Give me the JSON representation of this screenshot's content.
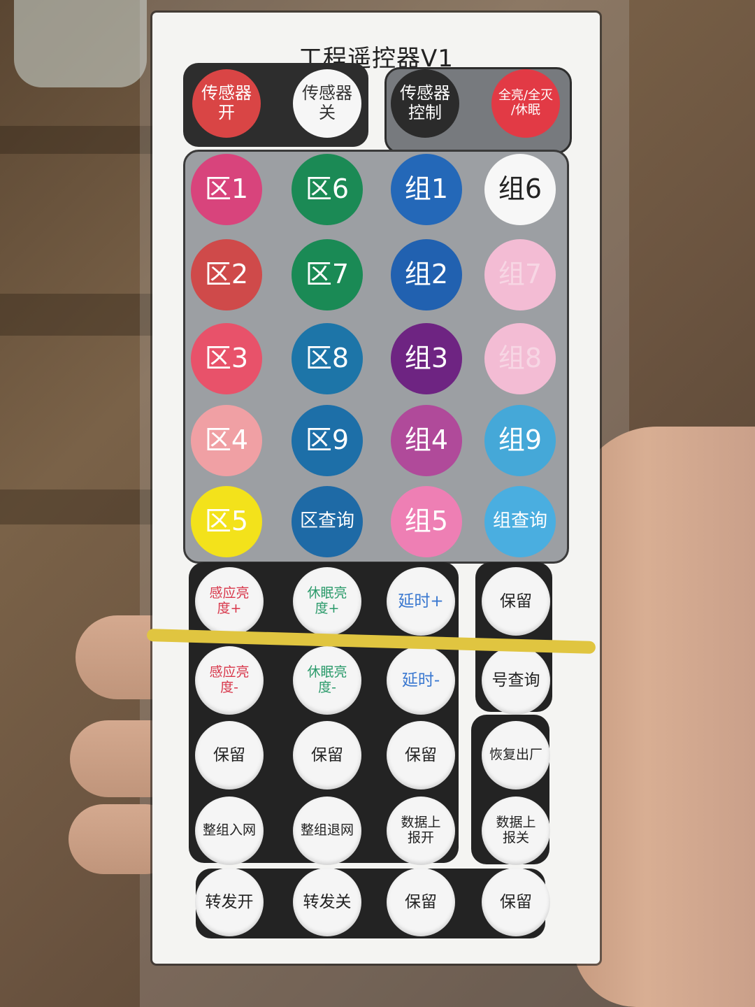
{
  "title": "工程遥控器V1",
  "top_row": [
    {
      "label": "传感器\n开",
      "bg": "#d94545",
      "fg": "#ffffff"
    },
    {
      "label": "传感器\n关",
      "bg": "#f6f6f6",
      "fg": "#333333"
    },
    {
      "label": "传感器\n控制",
      "bg": "#2b2b2b",
      "fg": "#ffffff"
    },
    {
      "label": "全亮/全灭\n/休眠",
      "bg": "#e23a45",
      "fg": "#ffffff"
    }
  ],
  "grid_rows": [
    [
      {
        "label": "区1",
        "bg": "#d8447c",
        "fg": "#ffffff"
      },
      {
        "label": "区6",
        "bg": "#1b8a55",
        "fg": "#ffffff"
      },
      {
        "label": "组1",
        "bg": "#2468b8",
        "fg": "#ffffff"
      },
      {
        "label": "组6",
        "bg": "#f7f7f7",
        "fg": "#222222"
      }
    ],
    [
      {
        "label": "区2",
        "bg": "#cf4a4a",
        "fg": "#ffffff"
      },
      {
        "label": "区7",
        "bg": "#1a8a55",
        "fg": "#ffffff"
      },
      {
        "label": "组2",
        "bg": "#2161b0",
        "fg": "#ffffff"
      },
      {
        "label": "组7",
        "bg": "#f3bcd4",
        "fg": "#f7d6e4"
      }
    ],
    [
      {
        "label": "区3",
        "bg": "#e8526a",
        "fg": "#ffffff"
      },
      {
        "label": "区8",
        "bg": "#1d75a8",
        "fg": "#ffffff"
      },
      {
        "label": "组3",
        "bg": "#6e2482",
        "fg": "#ffffff"
      },
      {
        "label": "组8",
        "bg": "#f3bcd4",
        "fg": "#f7d6e4"
      }
    ],
    [
      {
        "label": "区4",
        "bg": "#f0a0a4",
        "fg": "#ffffff"
      },
      {
        "label": "区9",
        "bg": "#1d6fa8",
        "fg": "#ffffff"
      },
      {
        "label": "组4",
        "bg": "#b04a9a",
        "fg": "#ffffff"
      },
      {
        "label": "组9",
        "bg": "#45a8d8",
        "fg": "#ffffff"
      }
    ],
    [
      {
        "label": "区5",
        "bg": "#f3e21b",
        "fg": "#ffffff"
      },
      {
        "label": "区查询",
        "bg": "#1e6aa6",
        "fg": "#ffffff"
      },
      {
        "label": "组5",
        "bg": "#ee7fb4",
        "fg": "#ffffff"
      },
      {
        "label": "组查询",
        "bg": "#4aaee0",
        "fg": "#ffffff"
      }
    ]
  ],
  "lower_rows": [
    [
      {
        "label": "感应亮\n度+",
        "fg": "#d8364a"
      },
      {
        "label": "休眠亮\n度+",
        "fg": "#2a9a6a"
      },
      {
        "label": "延时+",
        "fg": "#3a78d0"
      },
      {
        "label": "保留",
        "fg": "#222222"
      }
    ],
    [
      {
        "label": "感应亮\n度-",
        "fg": "#d8364a"
      },
      {
        "label": "休眠亮\n度-",
        "fg": "#2a9a6a"
      },
      {
        "label": "延时-",
        "fg": "#3a78d0"
      },
      {
        "label": "号查询",
        "fg": "#222222"
      }
    ],
    [
      {
        "label": "保留",
        "fg": "#222222"
      },
      {
        "label": "保留",
        "fg": "#222222"
      },
      {
        "label": "保留",
        "fg": "#222222"
      },
      {
        "label": "恢复出厂",
        "fg": "#222222"
      }
    ],
    [
      {
        "label": "整组入网",
        "fg": "#222222"
      },
      {
        "label": "整组退网",
        "fg": "#222222"
      },
      {
        "label": "数据上\n报开",
        "fg": "#222222"
      },
      {
        "label": "数据上\n报关",
        "fg": "#222222"
      }
    ],
    [
      {
        "label": "转发开",
        "fg": "#222222"
      },
      {
        "label": "转发关",
        "fg": "#222222"
      },
      {
        "label": "保留",
        "fg": "#222222"
      },
      {
        "label": "保留",
        "fg": "#222222"
      }
    ]
  ]
}
